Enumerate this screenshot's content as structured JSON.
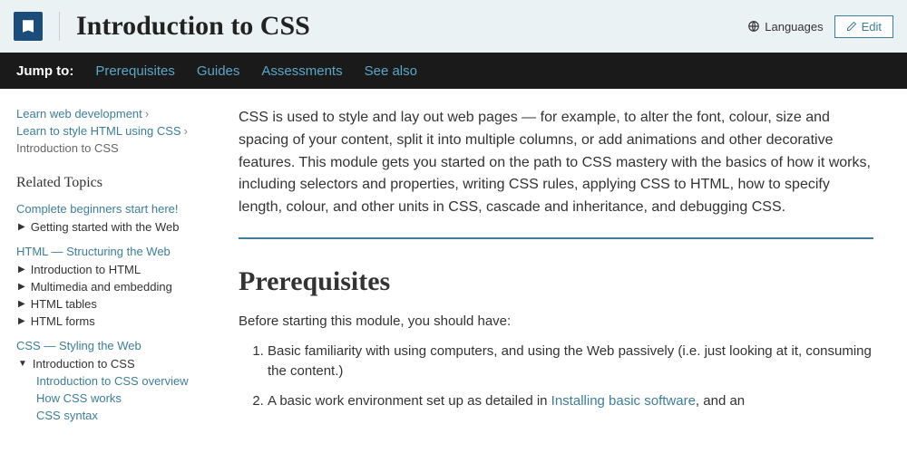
{
  "header": {
    "title": "Introduction to CSS",
    "languages_label": "Languages",
    "edit_label": "Edit"
  },
  "jumpbar": {
    "label": "Jump to:",
    "links": [
      "Prerequisites",
      "Guides",
      "Assessments",
      "See also"
    ]
  },
  "breadcrumbs": [
    "Learn web development",
    "Learn to style HTML using CSS",
    "Introduction to CSS"
  ],
  "related": {
    "title": "Related Topics",
    "sections": [
      {
        "head": "Complete beginners start here!",
        "items": [
          {
            "label": "Getting started with the Web",
            "open": false
          }
        ]
      },
      {
        "head": "HTML — Structuring the Web",
        "items": [
          {
            "label": "Introduction to HTML",
            "open": false
          },
          {
            "label": "Multimedia and embedding",
            "open": false
          },
          {
            "label": "HTML tables",
            "open": false
          },
          {
            "label": "HTML forms",
            "open": false
          }
        ]
      },
      {
        "head": "CSS — Styling the Web",
        "items": [
          {
            "label": "Introduction to CSS",
            "open": true,
            "subitems": [
              "Introduction to CSS overview",
              "How CSS works",
              "CSS syntax"
            ]
          }
        ]
      }
    ]
  },
  "main": {
    "intro": "CSS is used to style and lay out web pages — for example, to alter the font, colour, size and spacing of your content, split it into multiple columns, or add animations and other decorative features. This module gets you started on the path to CSS mastery with the basics of how it works, including selectors and properties, writing CSS rules, applying CSS to HTML, how to specify length, colour, and other units in CSS, cascade and inheritance, and debugging CSS.",
    "prereq_heading": "Prerequisites",
    "prereq_intro": "Before starting this module, you should have:",
    "prereq_items": [
      {
        "text": "Basic familiarity with using computers, and using the Web passively (i.e. just looking at it, consuming the content.)"
      },
      {
        "text_before": "A basic work environment set up as detailed in ",
        "link": "Installing basic software",
        "text_after": ", and an"
      }
    ]
  }
}
